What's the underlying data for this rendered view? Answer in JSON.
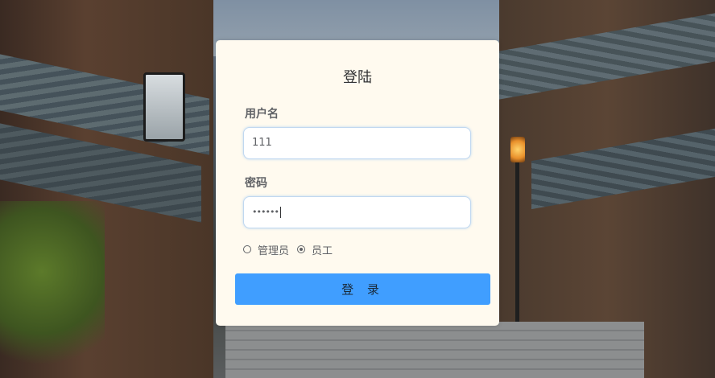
{
  "login": {
    "title": "登陆",
    "username_label": "用户名",
    "username_value": "111",
    "password_label": "密码",
    "password_masked": "••••••",
    "role_options": [
      {
        "label": "管理员",
        "checked": false
      },
      {
        "label": "员工",
        "checked": true
      }
    ],
    "submit_label": "登 录"
  },
  "colors": {
    "card_bg": "#fffaef",
    "button_bg": "#409eff",
    "label_text": "#606266",
    "input_border": "#c0d8f0"
  }
}
